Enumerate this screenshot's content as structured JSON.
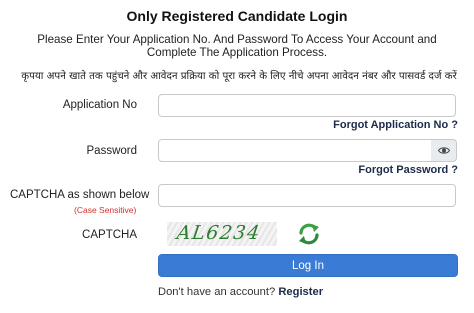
{
  "header": {
    "title": "Only Registered Candidate Login",
    "instruction": "Please Enter Your Application No. And Password To Access Your Account and Complete The Application Process.",
    "instruction_hindi": "कृपया अपने खाते तक पहुंचने और आवेदन प्रक्रिया को पूरा करने के लिए नीचे अपना आवेदन नंबर और पासवर्ड दर्ज करें"
  },
  "form": {
    "application_no_label": "Application No",
    "application_no_value": "",
    "forgot_application_no": "Forgot Application No ?",
    "password_label": "Password",
    "password_value": "",
    "forgot_password": "Forgot Password ?",
    "captcha_input_label": "CAPTCHA as shown below",
    "captcha_note": "(Case Sensitive)",
    "captcha_input_value": "",
    "captcha_label": "CAPTCHA",
    "captcha_text": "AL6234",
    "login_button": "Log In",
    "no_account_text": "Don't have an account?",
    "register_link": "Register"
  },
  "colors": {
    "button": "#3a7bd5",
    "captcha_text": "#2e7d32",
    "required_note": "#d32f2f",
    "link": "#1c2b4a"
  },
  "icons": {
    "password_toggle": "eye-icon",
    "captcha_refresh": "refresh-icon"
  }
}
